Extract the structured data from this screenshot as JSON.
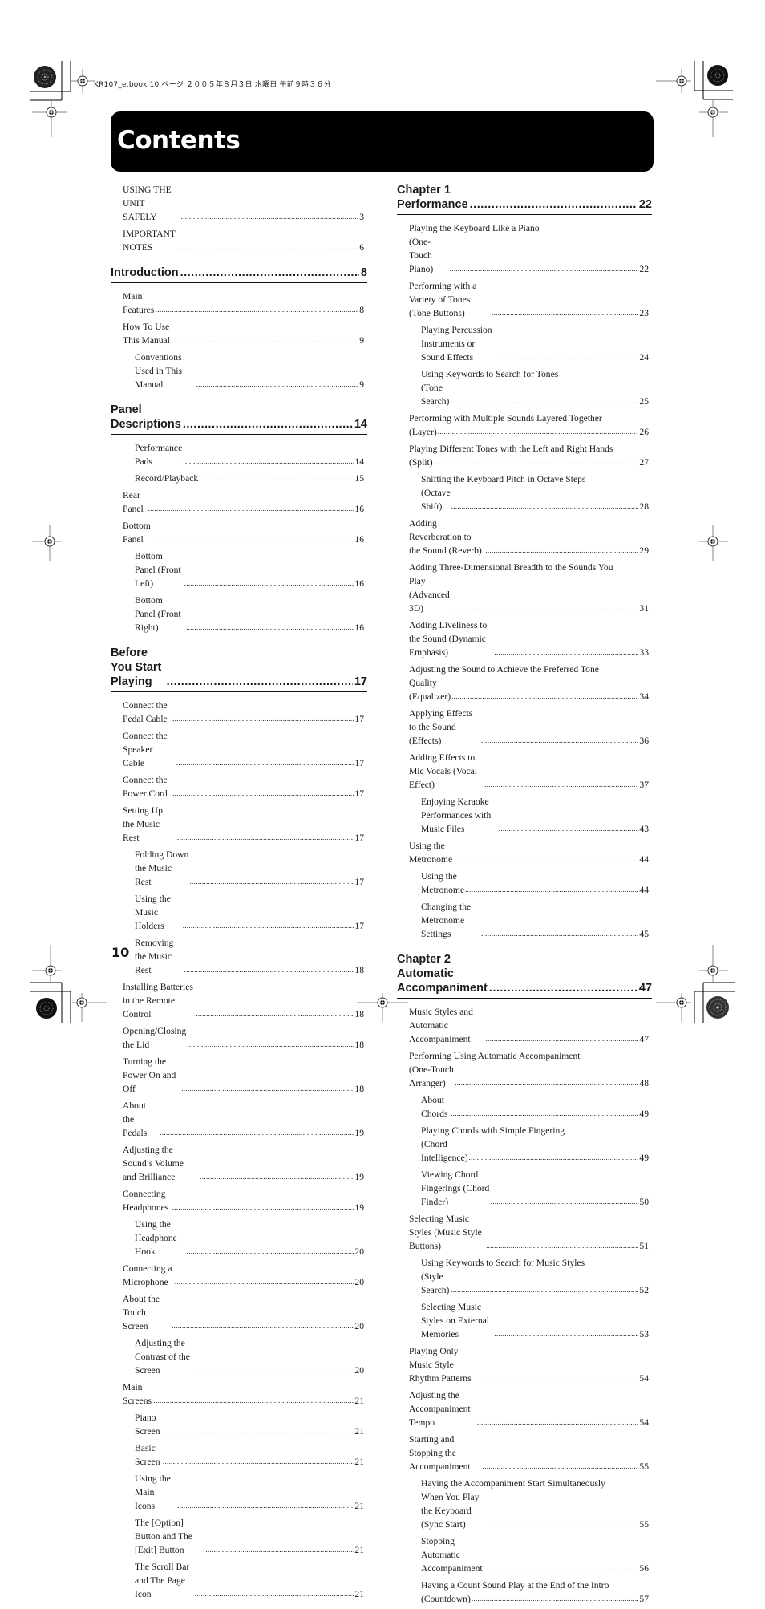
{
  "header": {
    "print_info": "KR107_e.book  10 ページ  ２００５年８月３日  水曜日  午前９時３６分"
  },
  "title": "Contents",
  "page_number": "10",
  "left_column": {
    "preface": [
      {
        "text": "USING THE UNIT SAFELY",
        "page": "3"
      },
      {
        "text": "IMPORTANT NOTES",
        "page": "6"
      }
    ],
    "sections": [
      {
        "heading": "Introduction",
        "page": "8",
        "entries": [
          {
            "text": "Main Features",
            "page": "8",
            "level": 1
          },
          {
            "text": "How To Use This Manual",
            "page": "9",
            "level": 1
          },
          {
            "text": "Conventions Used in This Manual",
            "page": "9",
            "level": 2
          }
        ]
      },
      {
        "heading": "Panel Descriptions",
        "page": "14",
        "entries": [
          {
            "text": "Performance Pads",
            "page": "14",
            "level": 2
          },
          {
            "text": "Record/Playback",
            "page": "15",
            "level": 2
          },
          {
            "text": "Rear Panel",
            "page": "16",
            "level": 1
          },
          {
            "text": "Bottom Panel",
            "page": "16",
            "level": 1
          },
          {
            "text": "Bottom Panel (Front Left)",
            "page": "16",
            "level": 2
          },
          {
            "text": "Bottom Panel (Front Right)",
            "page": "16",
            "level": 2
          }
        ]
      },
      {
        "heading": "Before You Start Playing",
        "page": "17",
        "entries": [
          {
            "text": "Connect the Pedal Cable",
            "page": "17",
            "level": 1
          },
          {
            "text": "Connect the Speaker Cable",
            "page": "17",
            "level": 1
          },
          {
            "text": "Connect the Power Cord",
            "page": "17",
            "level": 1
          },
          {
            "text": "Setting Up the Music Rest",
            "page": "17",
            "level": 1
          },
          {
            "text": "Folding Down the Music Rest",
            "page": "17",
            "level": 2
          },
          {
            "text": "Using the Music Holders",
            "page": "17",
            "level": 2
          },
          {
            "text": "Removing the Music Rest",
            "page": "18",
            "level": 2
          },
          {
            "text": "Installing Batteries in the Remote Control",
            "page": "18",
            "level": 1
          },
          {
            "text": "Opening/Closing the Lid",
            "page": "18",
            "level": 1
          },
          {
            "text": "Turning the Power On and Off",
            "page": "18",
            "level": 1
          },
          {
            "text": "About the Pedals",
            "page": "19",
            "level": 1
          },
          {
            "text": "Adjusting the Sound’s Volume and Brilliance",
            "page": "19",
            "level": 1
          },
          {
            "text": "Connecting Headphones",
            "page": "19",
            "level": 1
          },
          {
            "text": "Using the Headphone Hook",
            "page": "20",
            "level": 2
          },
          {
            "text": "Connecting a Microphone",
            "page": "20",
            "level": 1
          },
          {
            "text": "About the Touch Screen",
            "page": "20",
            "level": 1
          },
          {
            "text": "Adjusting the Contrast of the Screen",
            "page": "20",
            "level": 2
          },
          {
            "text": "Main Screens",
            "page": "21",
            "level": 1
          },
          {
            "text": "Piano Screen",
            "page": "21",
            "level": 2
          },
          {
            "text": "Basic Screen",
            "page": "21",
            "level": 2
          },
          {
            "text": "Using the Main Icons",
            "page": "21",
            "level": 2
          },
          {
            "text": "The [Option] Button and The [Exit] Button",
            "page": "21",
            "level": 2
          },
          {
            "text": "The Scroll Bar and The Page Icon",
            "page": "21",
            "level": 2
          }
        ]
      }
    ]
  },
  "right_column": {
    "sections": [
      {
        "heading": "Chapter 1 Performance",
        "page": "22",
        "entries": [
          {
            "text": "Playing the Keyboard Like a Piano",
            "text2": "(One-Touch Piano)",
            "page": "22",
            "level": 1
          },
          {
            "text": "Performing with a Variety of Tones (Tone Buttons)",
            "page": "23",
            "level": 1
          },
          {
            "text": "Playing Percussion Instruments or Sound Effects",
            "page": "24",
            "level": 2
          },
          {
            "text": "Using Keywords to Search for Tones",
            "text2": "(Tone Search)",
            "page": "25",
            "level": 2
          },
          {
            "text": "Performing with Multiple Sounds Layered Together",
            "text2": "(Layer)",
            "page": "26",
            "level": 1
          },
          {
            "text": "Playing Different Tones with the Left and Right Hands",
            "text2": "(Split)",
            "page": "27",
            "level": 1
          },
          {
            "text": "Shifting the Keyboard Pitch in Octave Steps",
            "text2": "(Octave Shift)",
            "page": "28",
            "level": 2
          },
          {
            "text": "Adding Reverberation to the Sound (Reverb)",
            "page": "29",
            "level": 1
          },
          {
            "text": "Adding Three-Dimensional Breadth to the Sounds You",
            "text2": "Play (Advanced 3D)",
            "page": "31",
            "level": 1
          },
          {
            "text": "Adding Liveliness to the Sound (Dynamic Emphasis)",
            "page": "33",
            "level": 1
          },
          {
            "text": "Adjusting the Sound to Achieve the Preferred Tone",
            "text2": "Quality (Equalizer)",
            "page": "34",
            "level": 1
          },
          {
            "text": "Applying Effects to the Sound (Effects)",
            "page": "36",
            "level": 1
          },
          {
            "text": "Adding Effects to Mic Vocals (Vocal Effect)",
            "page": "37",
            "level": 1
          },
          {
            "text": "Enjoying Karaoke Performances with Music Files",
            "page": "43",
            "level": 2
          },
          {
            "text": "Using the Metronome",
            "page": "44",
            "level": 1
          },
          {
            "text": "Using the Metronome",
            "page": "44",
            "level": 2
          },
          {
            "text": "Changing the Metronome Settings",
            "page": "45",
            "level": 2
          }
        ]
      },
      {
        "heading": "Chapter 2 Automatic Accompaniment",
        "page": "47",
        "entries": [
          {
            "text": "Music Styles and Automatic Accompaniment",
            "page": "47",
            "level": 1
          },
          {
            "text": "Performing Using Automatic Accompaniment",
            "text2": "(One-Touch Arranger)",
            "page": "48",
            "level": 1
          },
          {
            "text": "About Chords",
            "page": "49",
            "level": 2
          },
          {
            "text": "Playing Chords with Simple Fingering",
            "text2": "(Chord Intelligence)",
            "page": "49",
            "level": 2
          },
          {
            "text": "Viewing Chord Fingerings (Chord Finder)",
            "page": "50",
            "level": 2
          },
          {
            "text": "Selecting Music Styles (Music Style Buttons)",
            "page": "51",
            "level": 1
          },
          {
            "text": "Using Keywords to Search for Music Styles",
            "text2": "(Style Search)",
            "page": "52",
            "level": 2
          },
          {
            "text": "Selecting Music Styles on External Memories",
            "page": "53",
            "level": 2
          },
          {
            "text": "Playing Only Music Style Rhythm Patterns",
            "page": "54",
            "level": 1
          },
          {
            "text": "Adjusting the Accompaniment Tempo",
            "page": "54",
            "level": 1
          },
          {
            "text": "Starting and Stopping the Accompaniment",
            "page": "55",
            "level": 1
          },
          {
            "text": "Having the Accompaniment Start Simultaneously",
            "text2": "When You Play the Keyboard (Sync Start)",
            "page": "55",
            "level": 2
          },
          {
            "text": "Stopping Automatic Accompaniment",
            "page": "56",
            "level": 2
          },
          {
            "text": "Having a Count Sound Play at the End of the Intro",
            "text2": "(Countdown)",
            "page": "57",
            "level": 2
          }
        ]
      }
    ]
  }
}
